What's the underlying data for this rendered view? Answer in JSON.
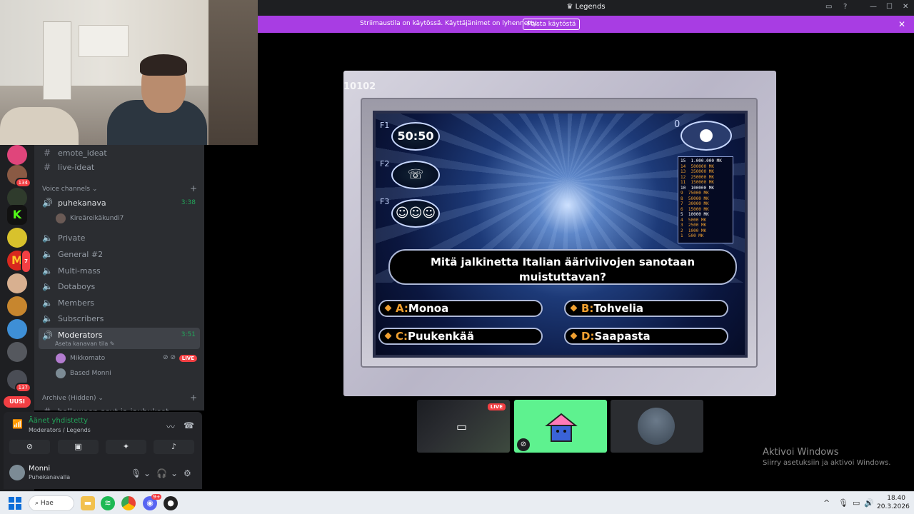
{
  "window": {
    "title": "Legends"
  },
  "banner": {
    "text": "Striimaustila on käytössä. Käyttäjänimet on lyhennetty.",
    "button": "Poista käytöstä"
  },
  "guild_badges": [
    "134",
    "7",
    "137"
  ],
  "new_badge": "UUSI",
  "channels": {
    "text": [
      "emote_ideat",
      "live-ideat"
    ],
    "voice_category": "Voice channels",
    "puhekanava": {
      "name": "puhekanava",
      "time": "3:38",
      "member": "Kireäreikäkundi7"
    },
    "voice": [
      "Private",
      "General #2",
      "Multi-mass",
      "Dotaboys",
      "Members",
      "Subscribers"
    ],
    "moderators": {
      "name": "Moderators",
      "time": "3:51",
      "status": "Aseta kanavan tila",
      "members": [
        "Mikkomato",
        "Based Monni"
      ],
      "live": "LIVE"
    },
    "archive_category": "Archive (Hidden)",
    "archive_partial": "halloween-asut-ja-jauhukset"
  },
  "voice_panel": {
    "status": "Äänet yhdistetty",
    "route": "Moderators / Legends"
  },
  "user": {
    "name": "Monni",
    "status": "Puhekanavalla"
  },
  "game": {
    "counter": "10102",
    "lifelines": [
      "50:50",
      "F1",
      "F2",
      "F3"
    ],
    "prize_counter": "0",
    "ladder": [
      {
        "n": "15",
        "v": "1.000.000 MK",
        "white": true
      },
      {
        "n": "14",
        "v": "500000 MK",
        "white": false
      },
      {
        "n": "13",
        "v": "350000 MK",
        "white": false
      },
      {
        "n": "12",
        "v": "250000 MK",
        "white": false
      },
      {
        "n": "11",
        "v": "150000 MK",
        "white": false
      },
      {
        "n": "10",
        "v": "100000 MK",
        "white": true
      },
      {
        "n": "9",
        "v": "75000 MK",
        "white": false
      },
      {
        "n": "8",
        "v": "50000 MK",
        "white": false
      },
      {
        "n": "7",
        "v": "30000 MK",
        "white": false
      },
      {
        "n": "6",
        "v": "15000 MK",
        "white": false
      },
      {
        "n": "5",
        "v": "10000 MK",
        "white": true
      },
      {
        "n": "4",
        "v": "5000 MK",
        "white": false
      },
      {
        "n": "3",
        "v": "2500 MK",
        "white": false
      },
      {
        "n": "2",
        "v": "1000 MK",
        "white": false
      },
      {
        "n": "1",
        "v": "500 MK",
        "white": false
      }
    ],
    "question": "Mitä jalkinetta Italian ääriviivojen sanotaan muistuttavan?",
    "answers": [
      {
        "letter": "A:",
        "text": "Monoa"
      },
      {
        "letter": "B:",
        "text": "Tohvelia"
      },
      {
        "letter": "C:",
        "text": "Puukenkää"
      },
      {
        "letter": "D:",
        "text": "Saapasta"
      }
    ]
  },
  "thumb_live": "LIVE",
  "activate": {
    "title": "Aktivoi Windows",
    "subtitle": "Siirry asetuksiin ja aktivoi Windows."
  },
  "taskbar": {
    "search": "Hae",
    "time": "18.40",
    "date": "20.3.2026",
    "discord_badge": "9+"
  },
  "colors": {
    "banner": "#a83de3",
    "discord_bg": "#2b2d31",
    "online_green": "#23a55a",
    "live_red": "#f23f43"
  }
}
